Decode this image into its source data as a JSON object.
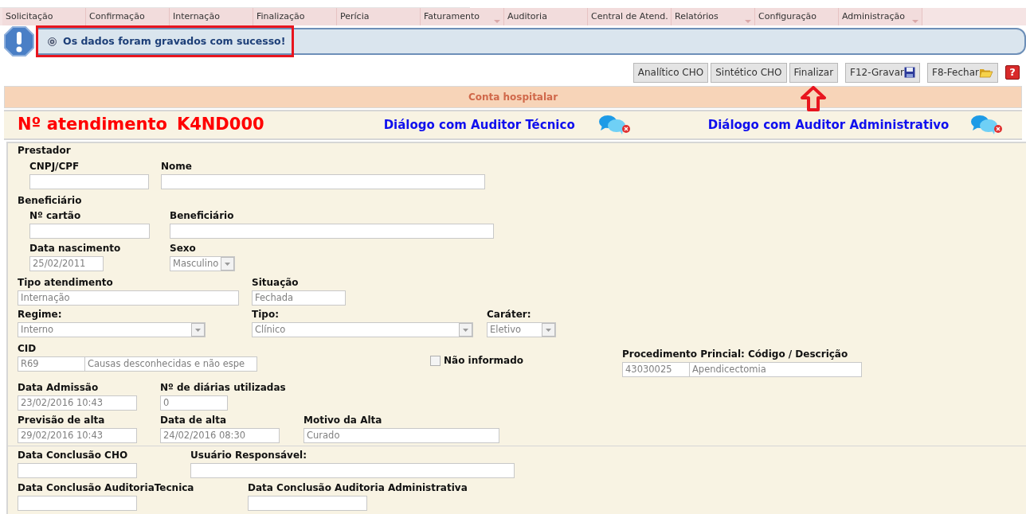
{
  "menu": [
    {
      "label": "Solicitação",
      "dropdown": false
    },
    {
      "label": "Confirmação",
      "dropdown": false
    },
    {
      "label": "Internação",
      "dropdown": false
    },
    {
      "label": "Finalização",
      "dropdown": false
    },
    {
      "label": "Perícia",
      "dropdown": false
    },
    {
      "label": "Faturamento",
      "dropdown": true
    },
    {
      "label": "Auditoria",
      "dropdown": false
    },
    {
      "label": "Central de Atend.",
      "dropdown": false
    },
    {
      "label": "Relatórios",
      "dropdown": true
    },
    {
      "label": "Configuração",
      "dropdown": false
    },
    {
      "label": "Administração",
      "dropdown": true
    }
  ],
  "message": {
    "text": "Os dados foram gravados com sucesso!",
    "annotated": true
  },
  "toolbar": [
    {
      "label": "Analítico CHO",
      "kind": "text",
      "annotated": false
    },
    {
      "label": "Sintético CHO",
      "kind": "text",
      "annotated": false
    },
    {
      "label": "Finalizar",
      "kind": "text",
      "annotated": true
    },
    {
      "label": "F12-Gravar",
      "kind": "save",
      "annotated": false
    },
    {
      "label": "F8-Fechar",
      "kind": "open",
      "annotated": false
    }
  ],
  "help": "?",
  "section_title": "Conta hospitalar",
  "atendimento": {
    "label": "Nº atendimento",
    "number": "K4ND000"
  },
  "dialogs": [
    {
      "label": "Diálogo com Auditor Técnico"
    },
    {
      "label": "Diálogo com Auditor Administrativo"
    }
  ],
  "form": {
    "rows": [
      [
        {
          "kind": "heading",
          "label": "Prestador"
        }
      ],
      [
        {
          "kind": "field",
          "label": "CNPJ/CPF"
        },
        {
          "kind": "field",
          "label": "Nome"
        }
      ],
      [
        {
          "kind": "heading",
          "label": "Beneficiário"
        }
      ],
      [
        {
          "kind": "field",
          "label": "Nº cartão"
        },
        {
          "kind": "field",
          "label": "Beneficiário"
        }
      ],
      [
        {
          "kind": "field",
          "label": "Data nascimento",
          "value": "25/02/2011"
        },
        {
          "kind": "select",
          "label": "Sexo",
          "value": "Masculino"
        }
      ],
      [
        {
          "kind": "field",
          "label": "Tipo atendimento",
          "value": "Internação"
        },
        {
          "kind": "field",
          "label": "Situação",
          "value": "Fechada"
        }
      ],
      [
        {
          "kind": "select",
          "label": "Regime:",
          "value": "Interno"
        },
        {
          "kind": "select",
          "label": "Tipo:",
          "value": "Clínico"
        },
        {
          "kind": "select",
          "label": "Caráter:",
          "value": "Eletivo"
        }
      ],
      [
        {
          "kind": "pair",
          "label": "CID",
          "values": [
            "R69",
            "Causas desconhecidas e não espe"
          ]
        },
        {
          "kind": "checkbox",
          "label": "Não informado",
          "checked": false
        },
        {
          "kind": "pair",
          "label": "Procedimento Princial: Código / Descrição",
          "values": [
            "43030025",
            "Apendicectomia"
          ]
        }
      ],
      [
        {
          "kind": "field",
          "label": "Data Admissão",
          "value": "23/02/2016 10:43"
        },
        {
          "kind": "field",
          "label": "Nº de diárias utilizadas",
          "value": "0"
        }
      ],
      [
        {
          "kind": "field",
          "label": "Previsão de alta",
          "value": "29/02/2016 10:43"
        },
        {
          "kind": "field",
          "label": "Data de alta",
          "value": "24/02/2016 08:30"
        },
        {
          "kind": "field",
          "label": "Motivo da Alta",
          "value": "Curado"
        }
      ],
      [
        {
          "kind": "field",
          "label": "Data Conclusão CHO"
        },
        {
          "kind": "field",
          "label": "Usuário Responsável:"
        }
      ],
      [
        {
          "kind": "field",
          "label": "Data Conclusão AuditoriaTecnica"
        },
        {
          "kind": "field",
          "label": "Data Conclusão Auditoria Administrativa"
        }
      ]
    ]
  }
}
